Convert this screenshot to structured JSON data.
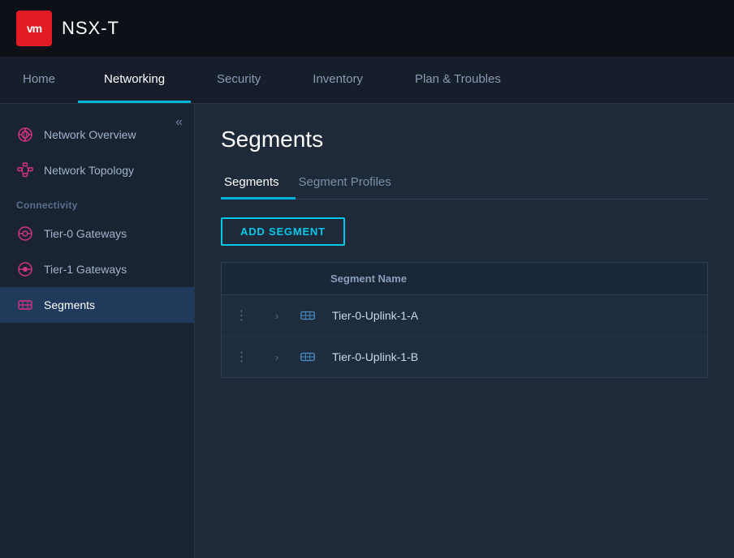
{
  "app": {
    "logo_text": "vm",
    "title": "NSX-T"
  },
  "nav": {
    "items": [
      {
        "id": "home",
        "label": "Home",
        "active": false
      },
      {
        "id": "networking",
        "label": "Networking",
        "active": true
      },
      {
        "id": "security",
        "label": "Security",
        "active": false
      },
      {
        "id": "inventory",
        "label": "Inventory",
        "active": false
      },
      {
        "id": "plan-troubles",
        "label": "Plan & Troubles",
        "active": false
      }
    ]
  },
  "sidebar": {
    "collapse_icon": "«",
    "items": [
      {
        "id": "network-overview",
        "label": "Network Overview",
        "icon": "network-overview-icon"
      },
      {
        "id": "network-topology",
        "label": "Network Topology",
        "icon": "network-topology-icon"
      }
    ],
    "connectivity_label": "Connectivity",
    "connectivity_items": [
      {
        "id": "tier0-gateways",
        "label": "Tier-0 Gateways",
        "icon": "tier0-icon"
      },
      {
        "id": "tier1-gateways",
        "label": "Tier-1 Gateways",
        "icon": "tier1-icon"
      },
      {
        "id": "segments",
        "label": "Segments",
        "icon": "segments-icon",
        "active": true
      }
    ]
  },
  "content": {
    "page_title": "Segments",
    "sub_tabs": [
      {
        "id": "segments-tab",
        "label": "Segments",
        "active": true
      },
      {
        "id": "segment-profiles-tab",
        "label": "Segment Profiles",
        "active": false
      }
    ],
    "add_button_label": "ADD SEGMENT",
    "table": {
      "headers": [
        {
          "id": "actions-col",
          "label": ""
        },
        {
          "id": "expand-col",
          "label": ""
        },
        {
          "id": "icon-col",
          "label": ""
        },
        {
          "id": "name-col",
          "label": "Segment Name"
        }
      ],
      "rows": [
        {
          "dots": "⋮",
          "chevron": "›",
          "name": "Tier-0-Uplink-1-A"
        },
        {
          "dots": "⋮",
          "chevron": "›",
          "name": "Tier-0-Uplink-1-B"
        }
      ]
    }
  }
}
